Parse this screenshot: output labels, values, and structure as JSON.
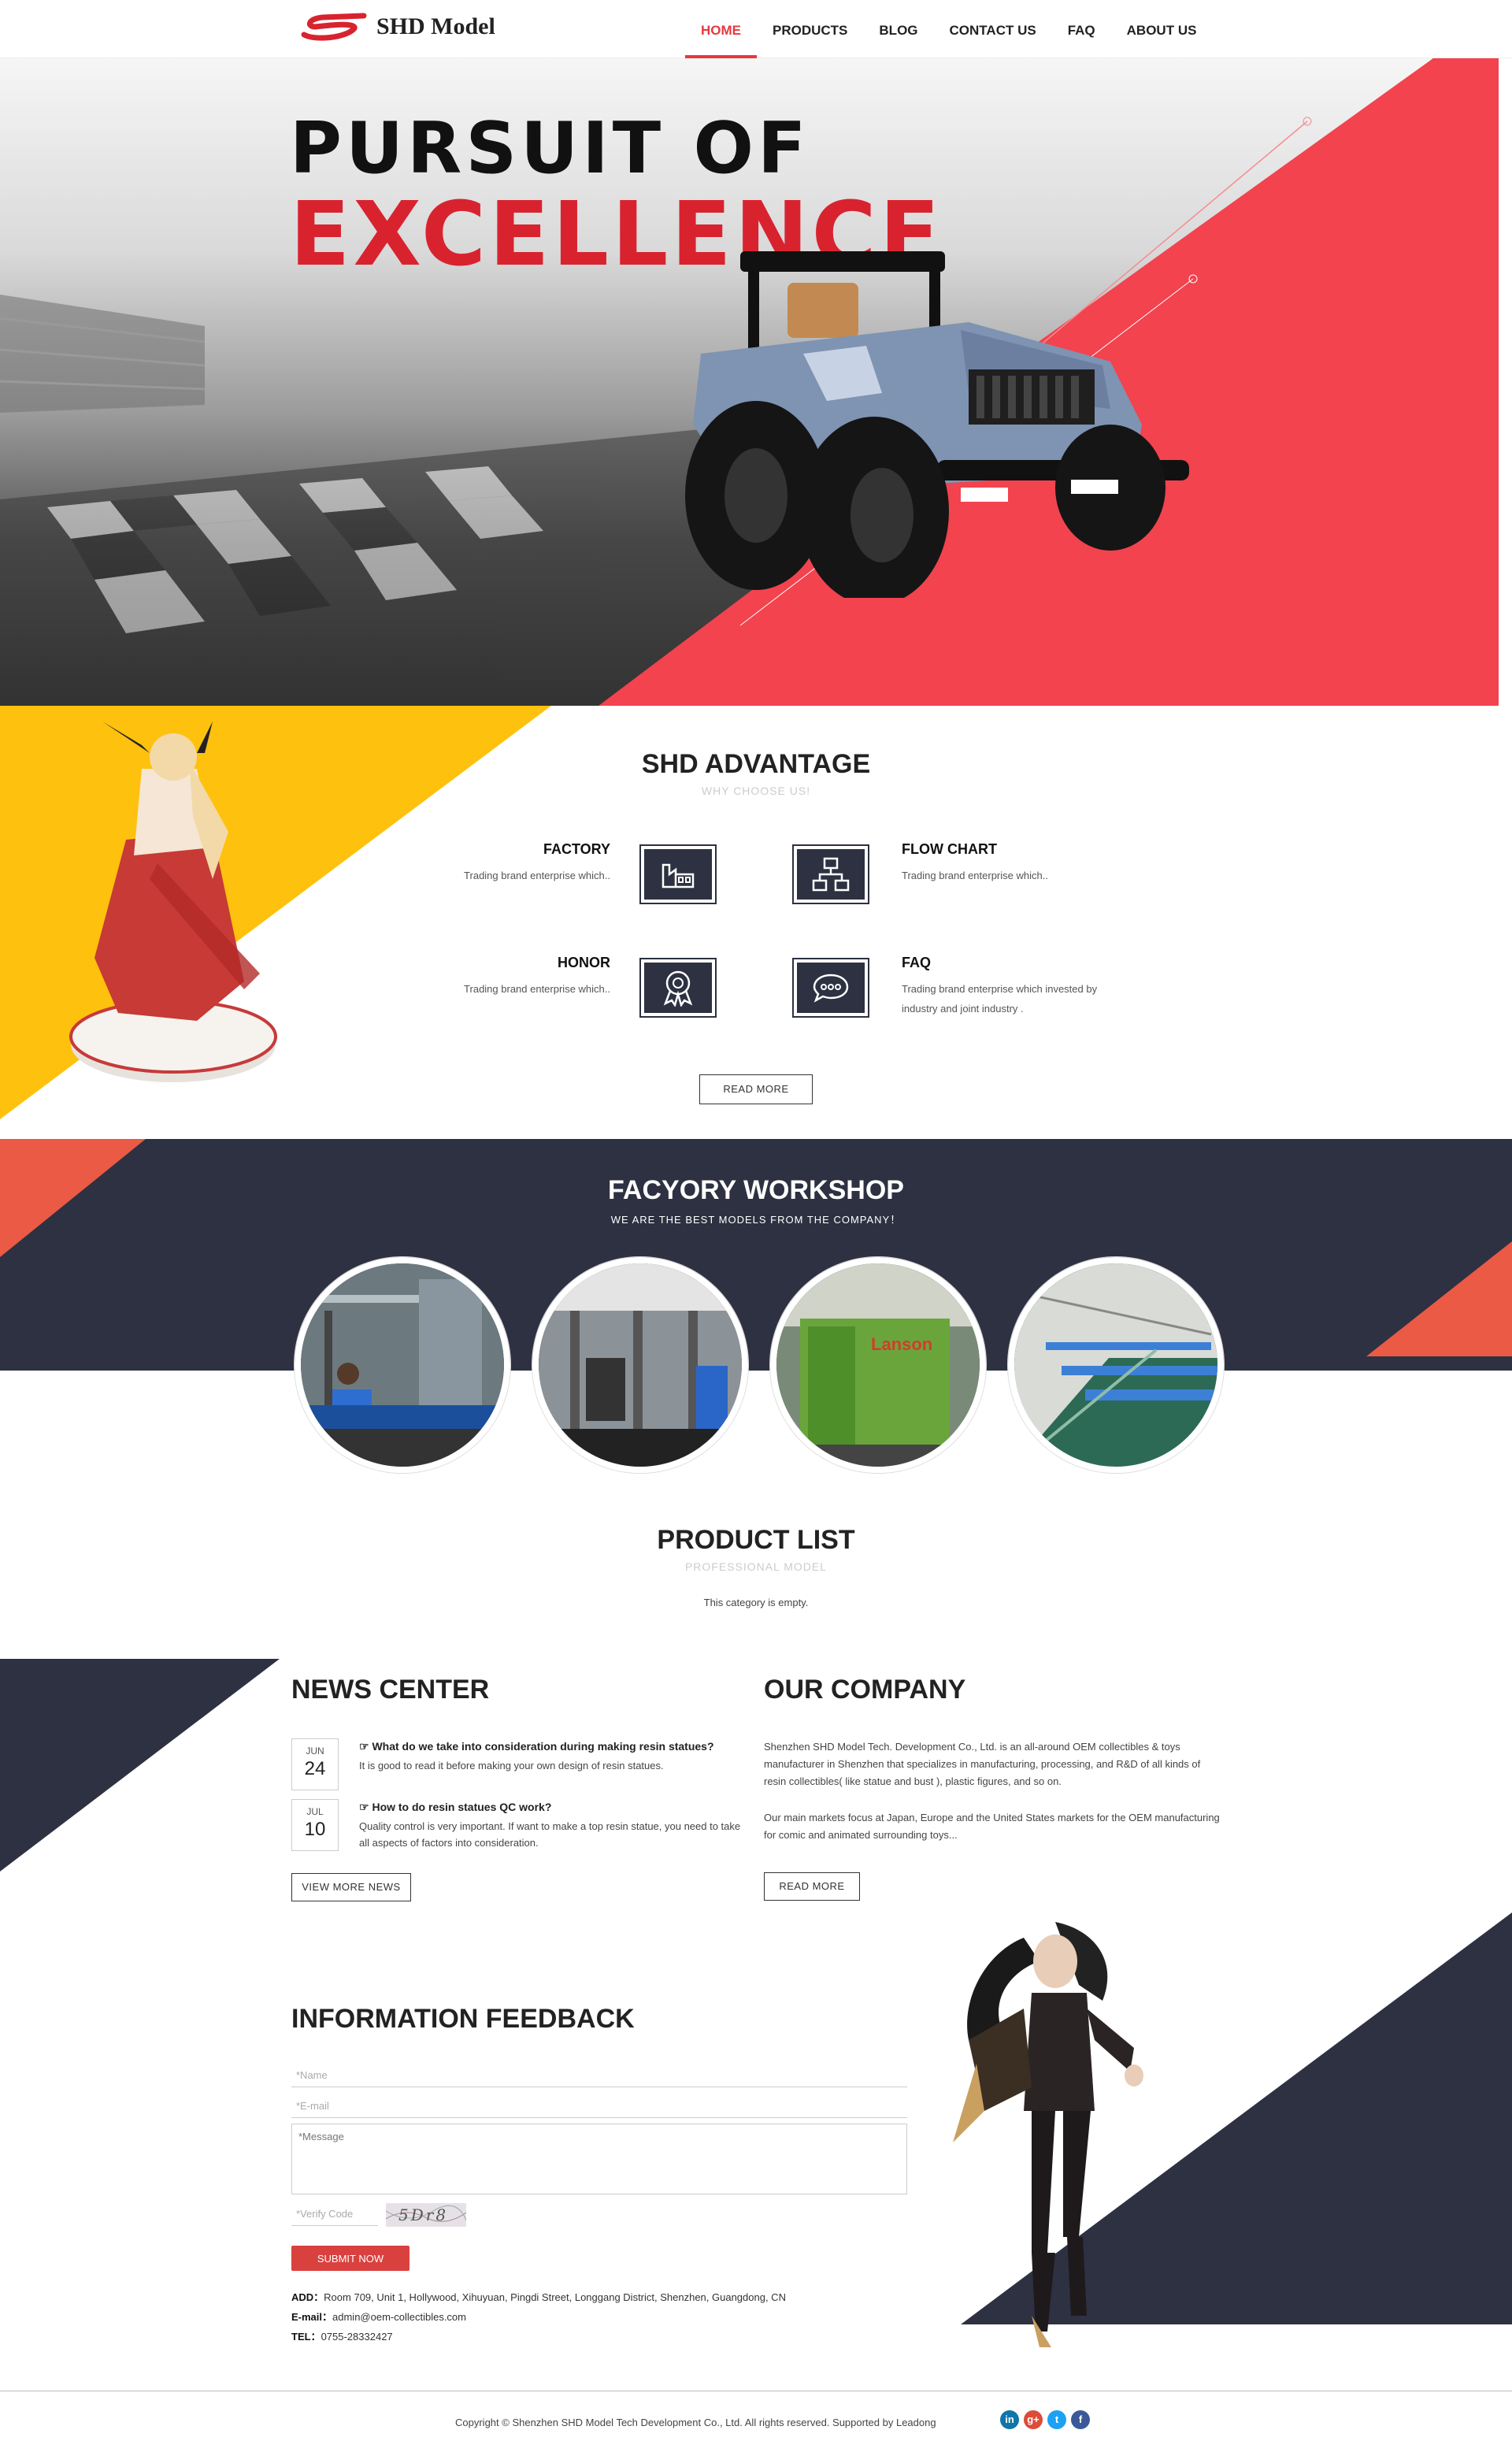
{
  "brand": {
    "name": "SHD Model",
    "logo_mark": "SS",
    "accent": "#e8373f"
  },
  "nav": {
    "items": [
      {
        "label": "HOME",
        "active": true
      },
      {
        "label": "PRODUCTS",
        "active": false
      },
      {
        "label": "BLOG",
        "active": false
      },
      {
        "label": "CONTACT US",
        "active": false
      },
      {
        "label": "FAQ",
        "active": false
      },
      {
        "label": "ABOUT US",
        "active": false
      }
    ]
  },
  "hero": {
    "line1": "PURSUIT OF",
    "line2": "EXCELLENCE"
  },
  "advantage": {
    "title": "SHD ADVANTAGE",
    "subtitle": "WHY CHOOSE US!",
    "items": [
      {
        "title": "FACTORY",
        "text": "Trading brand enterprise which..",
        "icon": "factory-icon"
      },
      {
        "title": "FLOW CHART",
        "text": "Trading brand enterprise which..",
        "icon": "flow-chart-icon"
      },
      {
        "title": "HONOR",
        "text": "Trading brand enterprise which..",
        "icon": "medal-icon"
      },
      {
        "title": "FAQ",
        "text": "Trading brand enterprise which invested by industry and joint industry .",
        "icon": "chat-bubble-icon"
      }
    ],
    "button": "READ MORE"
  },
  "workshop": {
    "title": "FACYORY WORKSHOP",
    "subtitle": "WE ARE THE BEST MODELS FROM THE COMPANY！",
    "photos": [
      "Lanson"
    ]
  },
  "products": {
    "title": "PRODUCT LIST",
    "subtitle": "PROFESSIONAL MODEL",
    "empty": "This category is empty."
  },
  "news": {
    "title": "NEWS CENTER",
    "items": [
      {
        "month": "JUN",
        "day": "24",
        "title": "What do we take into consideration during making resin statues?",
        "text": "It is good to read it before making your own design of resin statues."
      },
      {
        "month": "JUL",
        "day": "10",
        "title": "How to do resin statues QC work?",
        "text": "Quality control is very important. If want to make a top resin statue, you need to take all aspects of factors into consideration."
      }
    ],
    "button": "VIEW MORE NEWS"
  },
  "company": {
    "title": "OUR COMPANY",
    "p1": "Shenzhen SHD Model Tech. Development Co., Ltd. is an all-around OEM collectibles & toys manufacturer in Shenzhen that specializes in manufacturing, processing, and R&D of all kinds of resin collectibles( like statue and bust ), plastic figures, and so on.",
    "p2": "Our main markets focus at Japan, Europe and the United States markets for the OEM manufacturing for comic and animated surrounding toys...",
    "button": "READ MORE"
  },
  "feedback": {
    "title": "INFORMATION FEEDBACK",
    "name_placeholder": "*Name",
    "email_placeholder": "*E-mail",
    "message_placeholder": "*Message",
    "code_placeholder": "*Verify Code",
    "captcha": "5Dr8",
    "submit": "SUBMIT NOW"
  },
  "contact": {
    "add_label": "ADD：",
    "add": "Room 709, Unit 1, Hollywood, Xihuyuan, Pingdi Street, Longgang District, Shenzhen, Guangdong, CN",
    "email_label": "E-mail：",
    "email": "admin@oem-collectibles.com",
    "tel_label": "TEL：",
    "tel": "0755-28332427"
  },
  "footer": {
    "copyright": "Copyright © Shenzhen SHD Model Tech Development Co., Ltd. All rights reserved. Supported by Leadong",
    "social": [
      {
        "icon": "linkedin-icon",
        "glyph": "in",
        "color": "#0e76a8"
      },
      {
        "icon": "google-plus-icon",
        "glyph": "g+",
        "color": "#dd4b39"
      },
      {
        "icon": "twitter-icon",
        "glyph": "t",
        "color": "#1da1f2"
      },
      {
        "icon": "facebook-icon",
        "glyph": "f",
        "color": "#3b5998"
      }
    ]
  },
  "colors": {
    "navy": "#2d3141",
    "red": "#f2434e",
    "yellow": "#fec10e",
    "coral": "#ea5a45"
  }
}
